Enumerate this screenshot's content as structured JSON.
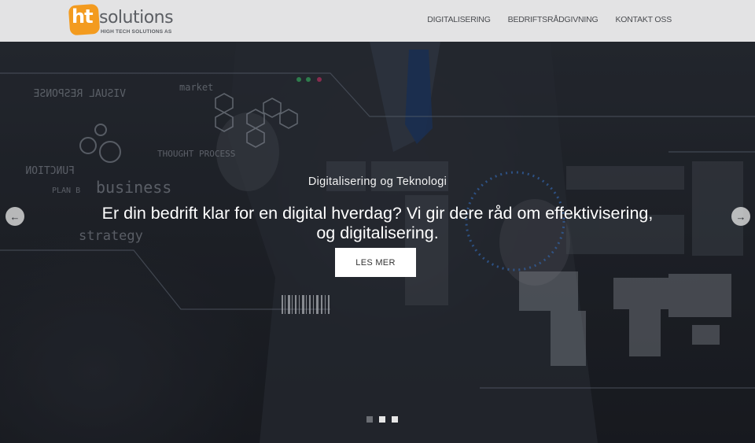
{
  "header": {
    "logo": {
      "badge_text": "ht",
      "word": "solutions",
      "tagline": "HIGH TECH SOLUTIONS AS",
      "badge_color": "#f39b1f"
    },
    "nav": [
      {
        "label": "DIGITALISERING"
      },
      {
        "label": "BEDRIFTSRÅDGIVNING"
      },
      {
        "label": "KONTAKT OSS"
      }
    ]
  },
  "hero": {
    "subtitle": "Digitalisering og Teknologi",
    "headline_line1": "Er din bedrift klar for en digital hverdag? Vi gir dere råd om effektivisering,",
    "headline_line2": "og digitalisering.",
    "cta_label": "LES MER",
    "prev_icon": "arrow-left-icon",
    "next_icon": "arrow-right-icon",
    "background_words": [
      "VISUAL RESPONSE",
      "market",
      "THOUGHT PROCESS",
      "FUNCTION",
      "business",
      "PLAN B",
      "strategy"
    ],
    "slides": 3,
    "active_slide": 1
  }
}
